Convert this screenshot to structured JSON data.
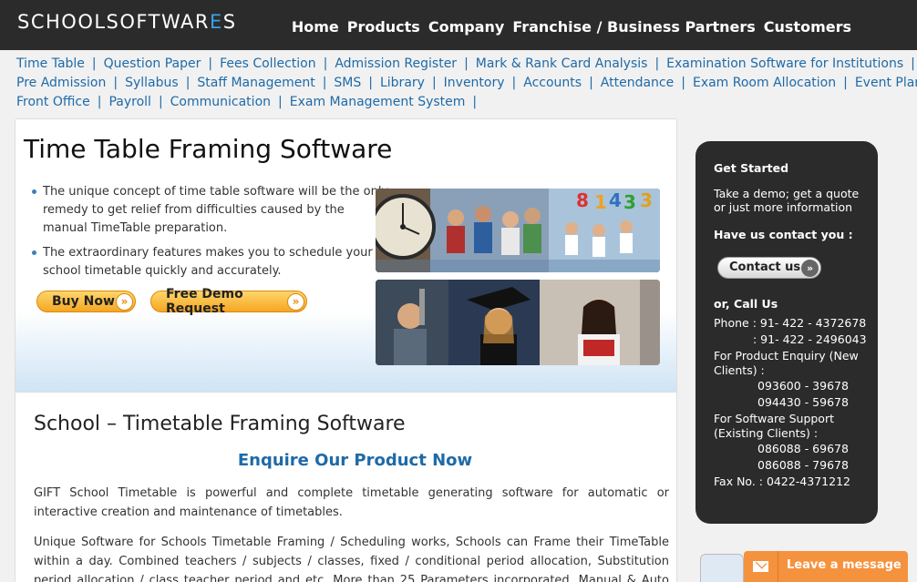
{
  "header": {
    "logo_main": "SCHOOLSOFTWAR",
    "logo_accent": "E",
    "logo_tail": "S",
    "nav": [
      "Home",
      "Products",
      "Company",
      "Franchise / Business Partners",
      "Customers"
    ]
  },
  "subnav": {
    "row1": [
      "Time Table",
      "Question Paper",
      "Fees Collection",
      "Admission Register",
      "Mark & Rank Card Analysis",
      "Examination Software for Institutions"
    ],
    "row2": [
      "Pre Admission",
      "Syllabus",
      "Staff Management",
      "SMS",
      "Library",
      "Inventory",
      "Accounts",
      "Attendance",
      "Exam Room Allocation",
      "Event Planning"
    ],
    "row3": [
      "Front Office",
      "Payroll",
      "Communication",
      "Exam Management System"
    ]
  },
  "banner": {
    "title": "Time Table Framing Software",
    "bullets": [
      "The unique concept of time table software will be the only remedy to get relief from difficulties caused by the manual TimeTable preparation.",
      "The extraordinary features makes you to schedule your school timetable quickly and accurately."
    ],
    "buy_now": "Buy Now",
    "free_demo": "Free Demo Request"
  },
  "content": {
    "section_title": "School – Timetable Framing Software",
    "enquire": "Enquire Our Product Now",
    "para1": "GIFT School Timetable is powerful and complete timetable generating software for automatic or interactive creation and maintenance of timetables.",
    "para2": "Unique Software for Schools Timetable Framing / Scheduling works, Schools can Frame their TimeTable within a day. Combined teachers / subjects / classes, fixed / conditional period allocation, Substitution period allocation / class teacher period and etc. More than 25 Parameters incorporated. Manual & Auto Generations. Reports like Whole week"
  },
  "sidebar": {
    "get_started": "Get Started",
    "demo_text": "Take a demo; get a quote or just more information",
    "contact_heading": "Have us contact you :",
    "contact_button": "Contact us",
    "call_us": "or, Call Us",
    "phone_label": "Phone : 91- 422 - 4372678",
    "phone2": ": 91- 422 - 2496043",
    "enquiry_label": "For Product Enquiry (New Clients) :",
    "enquiry1": "093600 - 39678",
    "enquiry2": "094430 - 59678",
    "support_label": "For Software Support (Existing Clients) :",
    "support1": "086088 - 69678",
    "support2": "086088 - 79678",
    "fax": "Fax No. : 0422-4371212"
  },
  "chat": {
    "label": "Leave a message"
  }
}
